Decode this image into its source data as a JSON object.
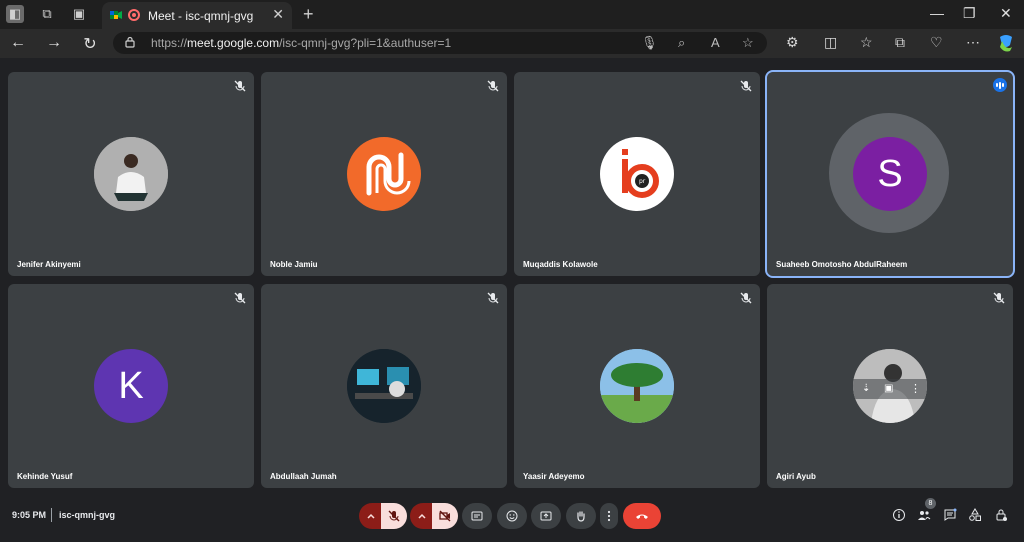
{
  "browser": {
    "tab_title": "Meet - isc-qmnj-gvg",
    "url_prefix": "https://",
    "url_host": "meet.google.com",
    "url_path": "/isc-qmnj-gvg?pli=1&authuser=1"
  },
  "participants": [
    {
      "name": "Jenifer Akinyemi",
      "avatar": "photo-person-sitting",
      "muted": true
    },
    {
      "name": "Noble Jamiu",
      "avatar": "orange-logo",
      "muted": true
    },
    {
      "name": "Muqaddis Kolawole",
      "avatar": "ib-logo",
      "muted": true
    },
    {
      "name": "Suaheeb Omotosho AbdulRaheem",
      "avatar_letter": "S",
      "avatar_color": "#7b1fa2",
      "speaking": true
    },
    {
      "name": "Kehinde Yusuf",
      "avatar_letter": "K",
      "avatar_color": "#5e35b1",
      "muted": true
    },
    {
      "name": "Abdullaah Jumah",
      "avatar": "photo-room",
      "muted": true
    },
    {
      "name": "Yaasir Adeyemo",
      "avatar": "photo-tree",
      "muted": true
    },
    {
      "name": "Agiri Ayub",
      "avatar": "photo-person-bw",
      "muted": true
    }
  ],
  "bottom": {
    "time": "9:05 PM",
    "meeting_code": "isc-qmnj-gvg",
    "people_count": "8"
  },
  "colors": {
    "accent": "#8ab4f8",
    "end_call": "#ea4335",
    "tile_bg": "#3c4043"
  }
}
